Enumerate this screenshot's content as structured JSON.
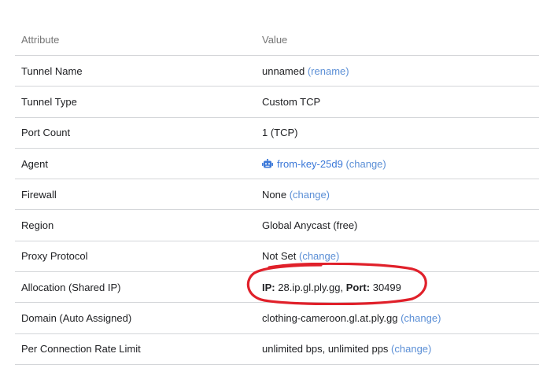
{
  "header": {
    "attribute": "Attribute",
    "value": "Value"
  },
  "rows": [
    {
      "attr": "Tunnel Name",
      "value": "unnamed",
      "link": "(rename)"
    },
    {
      "attr": "Tunnel Type",
      "value": "Custom TCP"
    },
    {
      "attr": "Port Count",
      "value": "1 (TCP)"
    },
    {
      "attr": "Agent",
      "agent_name": "from-key-25d9",
      "link": "(change)",
      "icon": "robot-icon"
    },
    {
      "attr": "Firewall",
      "value": "None",
      "link": "(change)"
    },
    {
      "attr": "Region",
      "value": "Global Anycast (free)"
    },
    {
      "attr": "Proxy Protocol",
      "value": "Not Set",
      "link": "(change)"
    },
    {
      "attr": "Allocation (Shared IP)",
      "ip_label": "IP:",
      "ip_value": "28.ip.gl.ply.gg,",
      "port_label": "Port:",
      "port_value": "30499"
    },
    {
      "attr": "Domain (Auto Assigned)",
      "value": "clothing-cameroon.gl.at.ply.gg",
      "link": "(change)"
    },
    {
      "attr": "Per Connection Rate Limit",
      "value": "unlimited bps, unlimited pps",
      "link": "(change)"
    }
  ],
  "colors": {
    "link": "#5b8fd6",
    "annotation": "#e0202a",
    "divider": "#d4d6d9"
  }
}
